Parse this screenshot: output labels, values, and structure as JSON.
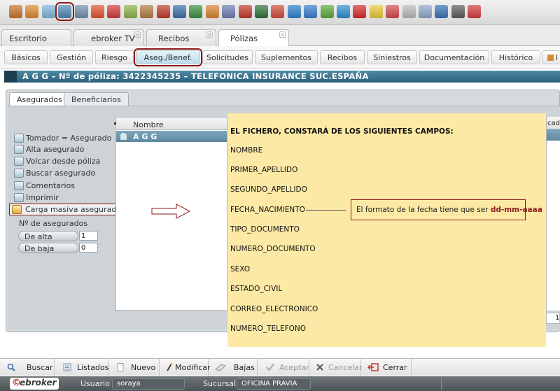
{
  "toolbar": {
    "icons": [
      {
        "name": "box-icon",
        "color": "#c7732a"
      },
      {
        "name": "person-icon",
        "color": "#d98a2e"
      },
      {
        "name": "user-icon",
        "color": "#7fb2d6"
      },
      {
        "name": "list-card-icon",
        "color": "#4f86b5",
        "selected": true
      },
      {
        "name": "document-icon",
        "color": "#6d8fa8"
      },
      {
        "name": "fire-icon",
        "color": "#e0532a"
      },
      {
        "name": "target-icon",
        "color": "#d33a3a"
      },
      {
        "name": "pencil-icon",
        "color": "#8ab04a"
      },
      {
        "name": "briefcase-icon",
        "color": "#b27a3c"
      },
      {
        "name": "medical-bag-icon",
        "color": "#c0392b"
      },
      {
        "name": "car-icon",
        "color": "#3b6ea5"
      },
      {
        "name": "building-icon",
        "color": "#3c8f3c"
      },
      {
        "name": "people-icon",
        "color": "#d9822b"
      },
      {
        "name": "group-icon",
        "color": "#6d7cb5"
      },
      {
        "name": "folder-icon",
        "color": "#c0392b"
      },
      {
        "name": "globe-icon",
        "color": "#2f6f3a"
      },
      {
        "name": "gear-icon",
        "color": "#d04a3a"
      },
      {
        "name": "ie-icon",
        "color": "#2b7fc9"
      },
      {
        "name": "arrows-icon",
        "color": "#3a7bc8"
      },
      {
        "name": "shield-icon",
        "color": "#5aa83a"
      },
      {
        "name": "refresh-icon",
        "color": "#2a8fd0"
      },
      {
        "name": "g-icon",
        "color": "#d42a2a"
      },
      {
        "name": "bulb-icon",
        "color": "#e8c83a"
      },
      {
        "name": "chart-icon",
        "color": "#d34a4a"
      },
      {
        "name": "notes-icon",
        "color": "#b8b8b8"
      },
      {
        "name": "calendar-icon",
        "color": "#8aa8c8"
      },
      {
        "name": "phone-icon",
        "color": "#3a6fb5"
      },
      {
        "name": "printer-icon",
        "color": "#5a5a5a"
      },
      {
        "name": "help-icon",
        "color": "#d33a3a"
      }
    ]
  },
  "tabs": [
    {
      "label": "Escritorio",
      "close": false
    },
    {
      "label": "ebroker TV",
      "close": true
    },
    {
      "label": "Recibos",
      "close": true
    },
    {
      "label": "Pólizas",
      "close": true,
      "active": true
    }
  ],
  "subtabs": [
    {
      "label": "Básicos"
    },
    {
      "label": "Gestión"
    },
    {
      "label": "Riesgo"
    },
    {
      "label": "Aseg./Benef.",
      "selected": true
    },
    {
      "label": "Solicitudes"
    },
    {
      "label": "Suplementos"
    },
    {
      "label": "Recibos"
    },
    {
      "label": "Siniestros"
    },
    {
      "label": "Documentación"
    },
    {
      "label": "Histórico"
    },
    {
      "label": "I"
    }
  ],
  "policy_bar": {
    "text": "A G G – Nº de póliza: 3422345235 – TELEFONICA INSURANCE SUC.ESPAÑA"
  },
  "inner_tabs": [
    {
      "label": "Asegurados",
      "active": true
    },
    {
      "label": "Beneficiarios"
    }
  ],
  "left_menu": [
    {
      "label": "Tomador = Asegurado",
      "icon": "person-card-icon"
    },
    {
      "label": "Alta asegurado",
      "icon": "add-user-icon"
    },
    {
      "label": "Volcar desde póliza",
      "icon": "transfer-icon"
    },
    {
      "label": "Buscar asegurado",
      "icon": "search-user-icon"
    },
    {
      "label": "Comentarios",
      "icon": "comment-icon"
    },
    {
      "label": "Imprimir",
      "icon": "printer-icon"
    },
    {
      "label": "Carga masiva asegurados",
      "icon": "bulk-upload-icon",
      "highlighted": true
    }
  ],
  "counts": {
    "label": "Nº de asegurados",
    "alta_label": "De alta",
    "alta_value": "1",
    "baja_label": "De baja",
    "baja_value": "0"
  },
  "grid": {
    "header": "Nombre",
    "rows": [
      "A G G"
    ],
    "right_header": "cado",
    "pager": "1"
  },
  "note": {
    "title": "EL FICHERO, CONSTARÁ DE LOS SIGUIENTES CAMPOS:",
    "fields": [
      "NOMBRE",
      "PRIMER_APELLIDO",
      "SEGUNDO_APELLIDO",
      "FECHA_NACIMIENTO",
      "TIPO_DOCUMENTO",
      "NUMERO_DOCUMENTO",
      "SEXO",
      "ESTADO_CIVIL",
      "CORREO_ELECTRONICO",
      "NUMERO_TELEFONO"
    ],
    "callout_prefix": "El formato de la fecha tiene que ser ",
    "callout_format": "dd-mm-aaaa",
    "bg_color": "#fde9a6"
  },
  "actions": [
    {
      "label": "Buscar",
      "icon": "search-icon",
      "enabled": true
    },
    {
      "label": "Listados",
      "icon": "list-icon",
      "enabled": true
    },
    {
      "label": "Nuevo",
      "icon": "new-document-icon",
      "enabled": true
    },
    {
      "label": "Modificar",
      "icon": "edit-icon",
      "enabled": true
    },
    {
      "label": "Bajas",
      "icon": "eraser-icon",
      "enabled": true
    },
    {
      "label": "Aceptar",
      "icon": "check-icon",
      "enabled": false
    },
    {
      "label": "Cancelar",
      "icon": "x-icon",
      "enabled": false
    },
    {
      "label": "Cerrar",
      "icon": "exit-icon",
      "enabled": true
    }
  ],
  "status": {
    "logo": "ebroker",
    "usuario_label": "Usuario",
    "usuario_value": "soraya",
    "sucursal_label": "Sucursal",
    "sucursal_value": "OFICINA PRAVIA"
  }
}
